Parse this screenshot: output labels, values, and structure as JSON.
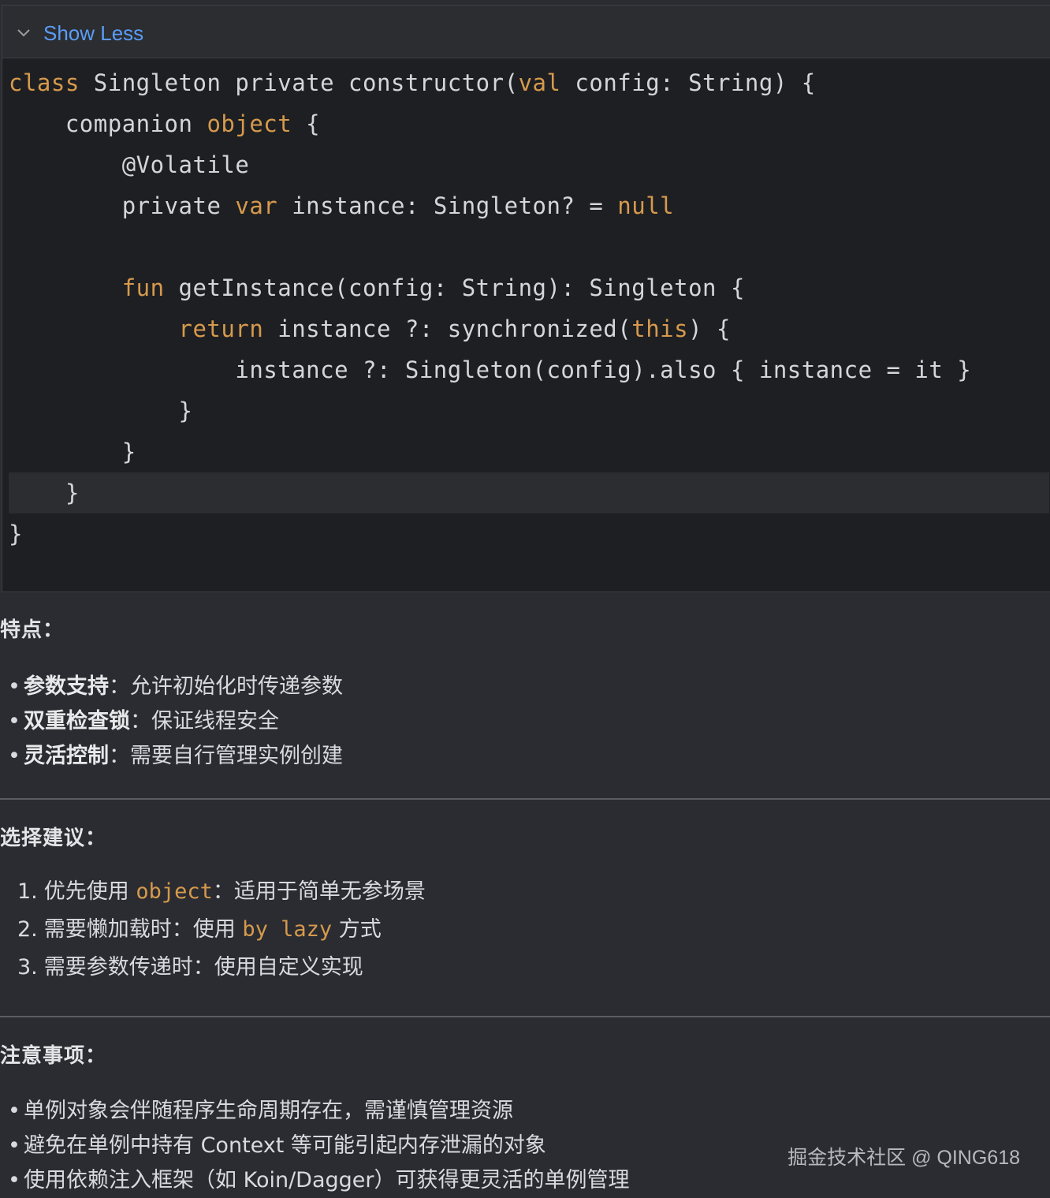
{
  "code_block": {
    "toggle_label": "Show Less",
    "lines": [
      {
        "indent": 0,
        "tokens": [
          {
            "t": "class",
            "kw": true
          },
          {
            "t": " Singleton private constructor("
          },
          {
            "t": "val",
            "kw": true
          },
          {
            "t": " config: String) {"
          }
        ]
      },
      {
        "indent": 1,
        "tokens": [
          {
            "t": "companion "
          },
          {
            "t": "object",
            "kw": true
          },
          {
            "t": " {"
          }
        ]
      },
      {
        "indent": 2,
        "tokens": [
          {
            "t": "@Volatile"
          }
        ]
      },
      {
        "indent": 2,
        "tokens": [
          {
            "t": "private "
          },
          {
            "t": "var",
            "kw": true
          },
          {
            "t": " instance: Singleton? = "
          },
          {
            "t": "null",
            "kw": true
          }
        ]
      },
      {
        "indent": 0,
        "tokens": []
      },
      {
        "indent": 2,
        "tokens": [
          {
            "t": "fun",
            "kw": true
          },
          {
            "t": " getInstance(config: String): Singleton {"
          }
        ]
      },
      {
        "indent": 3,
        "tokens": [
          {
            "t": "return",
            "kw": true
          },
          {
            "t": " instance ?: synchronized("
          },
          {
            "t": "this",
            "kw": true
          },
          {
            "t": ") {"
          }
        ]
      },
      {
        "indent": 4,
        "tokens": [
          {
            "t": "instance ?: Singleton(config).also { instance = it }"
          }
        ]
      },
      {
        "indent": 3,
        "tokens": [
          {
            "t": "}"
          }
        ]
      },
      {
        "indent": 2,
        "tokens": [
          {
            "t": "}"
          }
        ]
      },
      {
        "indent": 1,
        "tokens": [
          {
            "t": "}"
          }
        ],
        "highlight": true
      },
      {
        "indent": 0,
        "tokens": [
          {
            "t": "}"
          }
        ]
      }
    ]
  },
  "features": {
    "heading": "特点：",
    "items": [
      {
        "bold": "参数支持",
        "sep": "：",
        "text": "允许初始化时传递参数"
      },
      {
        "bold": "双重检查锁",
        "sep": "：",
        "text": "保证线程安全"
      },
      {
        "bold": "灵活控制",
        "sep": "：",
        "text": "需要自行管理实例创建"
      }
    ]
  },
  "advice": {
    "heading": "选择建议：",
    "items": [
      {
        "num": "1.",
        "before": "优先使用 ",
        "code": "object",
        "after": "：适用于简单无参场景"
      },
      {
        "num": "2.",
        "before": "需要懒加载时：使用 ",
        "code": "by lazy",
        "after": " 方式"
      },
      {
        "num": "3.",
        "before": "需要参数传递时：使用自定义实现",
        "code": "",
        "after": ""
      }
    ]
  },
  "notes": {
    "heading": "注意事项：",
    "items": [
      "单例对象会伴随程序生命周期存在，需谨慎管理资源",
      "避免在单例中持有 Context 等可能引起内存泄漏的对象",
      "使用依赖注入框架（如 Koin/Dagger）可获得更灵活的单例管理"
    ]
  },
  "watermark": "掘金技术社区 @ QING618",
  "colors": {
    "background": "#2b2c31",
    "code_background": "#1e1f22",
    "keyword": "#d69a4d",
    "link": "#5b9cf6"
  }
}
